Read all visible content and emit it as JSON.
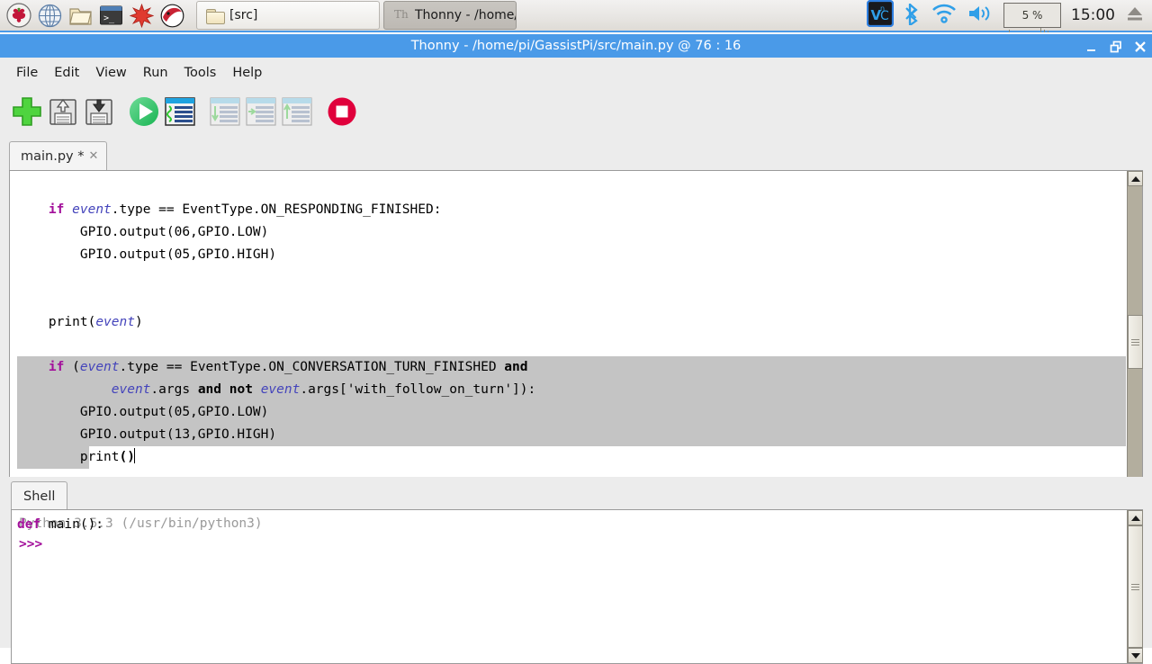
{
  "taskbar": {
    "launchers": [
      {
        "name": "raspberry-menu-icon",
        "label": "Raspberry Pi Menu"
      },
      {
        "name": "web-browser-icon",
        "label": "Web Browser"
      },
      {
        "name": "file-manager-icon",
        "label": "File Manager"
      },
      {
        "name": "terminal-icon",
        "label": "Terminal"
      },
      {
        "name": "mathematica-icon",
        "label": "Mathematica"
      },
      {
        "name": "wolfram-icon",
        "label": "Wolfram"
      }
    ],
    "windows": [
      {
        "name": "taskbar-window-src",
        "label": "[src]",
        "icon": "folder-icon",
        "active": false
      },
      {
        "name": "taskbar-window-thonny",
        "label": "Thonny  -  /home/pi/…",
        "icon": "thonny-icon",
        "active": true
      }
    ],
    "tray": {
      "vnc_icon": "vnc-icon",
      "vnc_label": "VNC",
      "bluetooth_icon": "bluetooth-icon",
      "wifi_icon": "wifi-icon",
      "volume_icon": "volume-icon",
      "cpu_label": "5 %",
      "clock": "15:00",
      "eject_icon": "eject-icon"
    }
  },
  "window": {
    "title": "Thonny  -  /home/pi/GassistPi/src/main.py  @  76 : 16",
    "buttons": {
      "minimize": "minimize-button",
      "maximize": "maximize-button",
      "close": "close-button"
    }
  },
  "menubar": {
    "items": [
      {
        "label": "File"
      },
      {
        "label": "Edit"
      },
      {
        "label": "View"
      },
      {
        "label": "Run"
      },
      {
        "label": "Tools"
      },
      {
        "label": "Help"
      }
    ]
  },
  "toolbar": {
    "buttons": [
      {
        "name": "new-file-button",
        "icon": "plus-icon",
        "enabled": true
      },
      {
        "name": "load-file-button",
        "icon": "floppy-up-icon",
        "enabled": true
      },
      {
        "name": "save-file-button",
        "icon": "floppy-down-icon",
        "enabled": true
      },
      {
        "name": "run-button",
        "icon": "play-icon",
        "enabled": true
      },
      {
        "name": "debug-button",
        "icon": "debug-window-icon",
        "enabled": true
      },
      {
        "name": "step-over-button",
        "icon": "step-over-icon",
        "enabled": false
      },
      {
        "name": "step-into-button",
        "icon": "step-into-icon",
        "enabled": false
      },
      {
        "name": "step-out-button",
        "icon": "step-out-icon",
        "enabled": false
      },
      {
        "name": "stop-button",
        "icon": "stop-icon",
        "enabled": true
      }
    ]
  },
  "editor": {
    "tab": {
      "label": "main.py *",
      "close_glyph": "✕"
    },
    "lines": [
      {
        "indent": 0,
        "selected": false,
        "tokens": []
      },
      {
        "indent": 4,
        "selected": false,
        "tokens": [
          {
            "t": "if ",
            "c": "kw"
          },
          {
            "t": "event",
            "c": "var"
          },
          {
            "t": ".type == EventType.ON_RESPONDING_FINISHED:",
            "c": ""
          }
        ]
      },
      {
        "indent": 8,
        "selected": false,
        "tokens": [
          {
            "t": "GPIO.output(06,GPIO.LOW)",
            "c": ""
          }
        ]
      },
      {
        "indent": 8,
        "selected": false,
        "tokens": [
          {
            "t": "GPIO.output(05,GPIO.HIGH)",
            "c": ""
          }
        ]
      },
      {
        "indent": 0,
        "selected": false,
        "tokens": []
      },
      {
        "indent": 0,
        "selected": false,
        "tokens": []
      },
      {
        "indent": 4,
        "selected": false,
        "tokens": [
          {
            "t": "print(",
            "c": ""
          },
          {
            "t": "event",
            "c": "var"
          },
          {
            "t": ")",
            "c": ""
          }
        ]
      },
      {
        "indent": 0,
        "selected": false,
        "tokens": []
      },
      {
        "indent": 4,
        "selected": true,
        "selband": 0,
        "tokens": [
          {
            "t": "if ",
            "c": "kw"
          },
          {
            "t": "(",
            "c": ""
          },
          {
            "t": "event",
            "c": "var"
          },
          {
            "t": ".type == EventType.ON_CONVERSATION_TURN_FINISHED ",
            "c": ""
          },
          {
            "t": "and",
            "c": "kwb"
          }
        ]
      },
      {
        "indent": 12,
        "selected": true,
        "selband": 0,
        "tokens": [
          {
            "t": "event",
            "c": "var"
          },
          {
            "t": ".args ",
            "c": ""
          },
          {
            "t": "and",
            "c": "kwb"
          },
          {
            "t": " ",
            "c": ""
          },
          {
            "t": "not",
            "c": "kwb"
          },
          {
            "t": " ",
            "c": ""
          },
          {
            "t": "event",
            "c": "var"
          },
          {
            "t": ".args['with_follow_on_turn']):",
            "c": ""
          }
        ]
      },
      {
        "indent": 8,
        "selected": true,
        "selband": 0,
        "tokens": [
          {
            "t": "GPIO.output(05,GPIO.LOW)",
            "c": ""
          }
        ]
      },
      {
        "indent": 8,
        "selected": true,
        "selband": 0,
        "tokens": [
          {
            "t": "GPIO.output(13,GPIO.HIGH)",
            "c": ""
          }
        ]
      },
      {
        "indent": 8,
        "selected": false,
        "selband": 80,
        "cursor": true,
        "tokens": [
          {
            "t": "print",
            "c": ""
          },
          {
            "t": "()",
            "c": "b"
          }
        ]
      },
      {
        "indent": 0,
        "selected": false,
        "tokens": []
      },
      {
        "indent": 0,
        "selected": false,
        "tokens": []
      },
      {
        "indent": 0,
        "selected": false,
        "tokens": [
          {
            "t": "def ",
            "c": "kw"
          },
          {
            "t": "main():",
            "c": ""
          }
        ]
      }
    ]
  },
  "shell": {
    "tab_label": "Shell",
    "banner": "Python 3.5.3 (/usr/bin/python3)",
    "prompt": ">>>"
  },
  "colors": {
    "titlebar": "#4a9ae8",
    "keyword": "#a3109b",
    "variable": "#4444bb",
    "selection": "#c4c4c4",
    "shell_banner": "#9a9a9a"
  }
}
